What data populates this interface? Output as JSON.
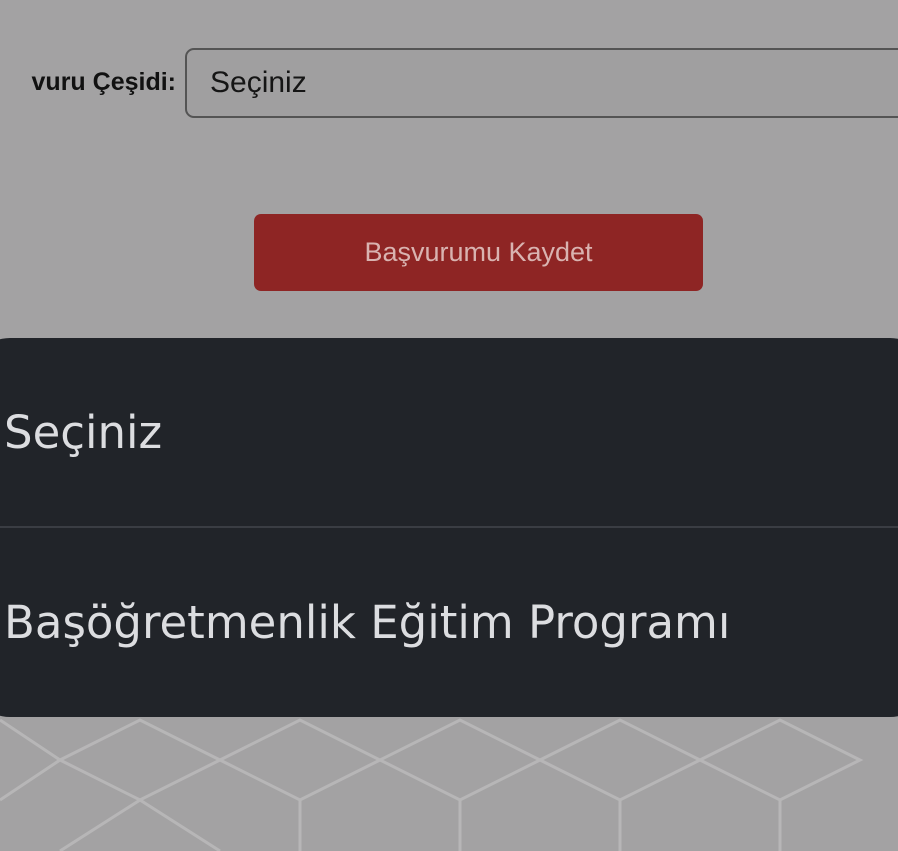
{
  "form": {
    "type_label": "vuru Çeşidi:",
    "type_select_value": "Seçiniz"
  },
  "actions": {
    "save_label": "Başvurumu Kaydet"
  },
  "dropdown": {
    "options": [
      {
        "label": "Seçiniz"
      },
      {
        "label": "Başöğretmenlik Eğitim Programı"
      }
    ]
  },
  "colors": {
    "overlay_background": "#a3a2a3",
    "button_red": "#8e2524",
    "dropdown_background": "#212429",
    "dropdown_text": "#dcdde0"
  }
}
